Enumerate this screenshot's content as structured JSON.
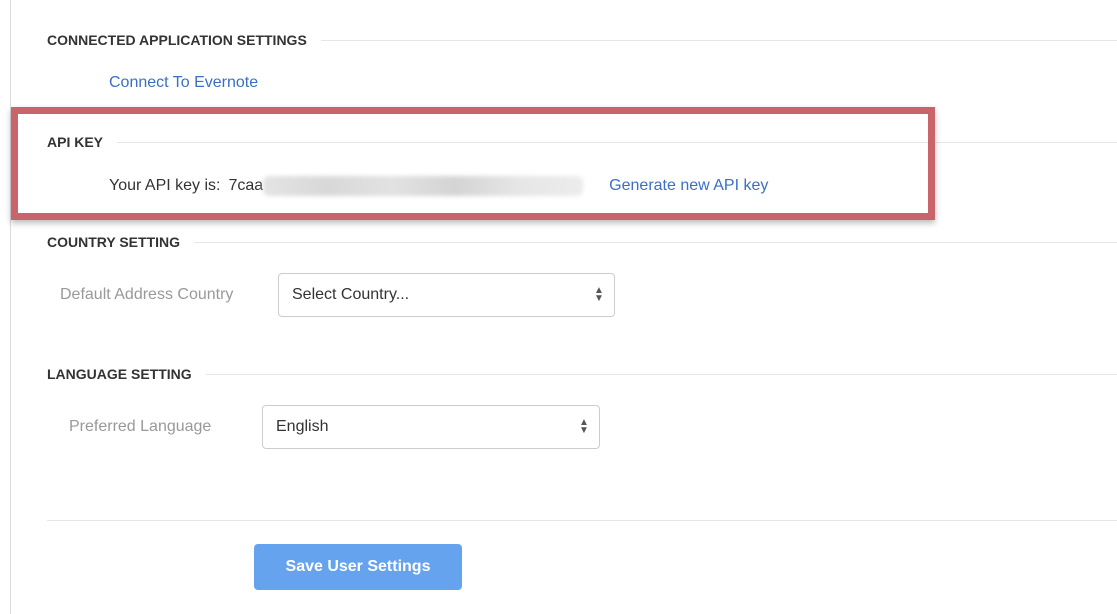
{
  "connected_apps": {
    "heading": "CONNECTED APPLICATION SETTINGS",
    "evernote_link": "Connect To Evernote"
  },
  "api_key": {
    "heading": "API KEY",
    "label": "Your API key is:",
    "key_prefix": "7caa",
    "generate_link": "Generate new API key"
  },
  "country": {
    "heading": "COUNTRY SETTING",
    "label": "Default Address Country",
    "selected": "Select Country..."
  },
  "language": {
    "heading": "LANGUAGE SETTING",
    "label": "Preferred Language",
    "selected": "English"
  },
  "actions": {
    "save_label": "Save User Settings"
  },
  "colors": {
    "link": "#3a6fc4",
    "highlight_border": "#c8646a",
    "save_button": "#66a3ee"
  },
  "icons": {
    "select_arrows": "up-down-chevrons-icon"
  }
}
